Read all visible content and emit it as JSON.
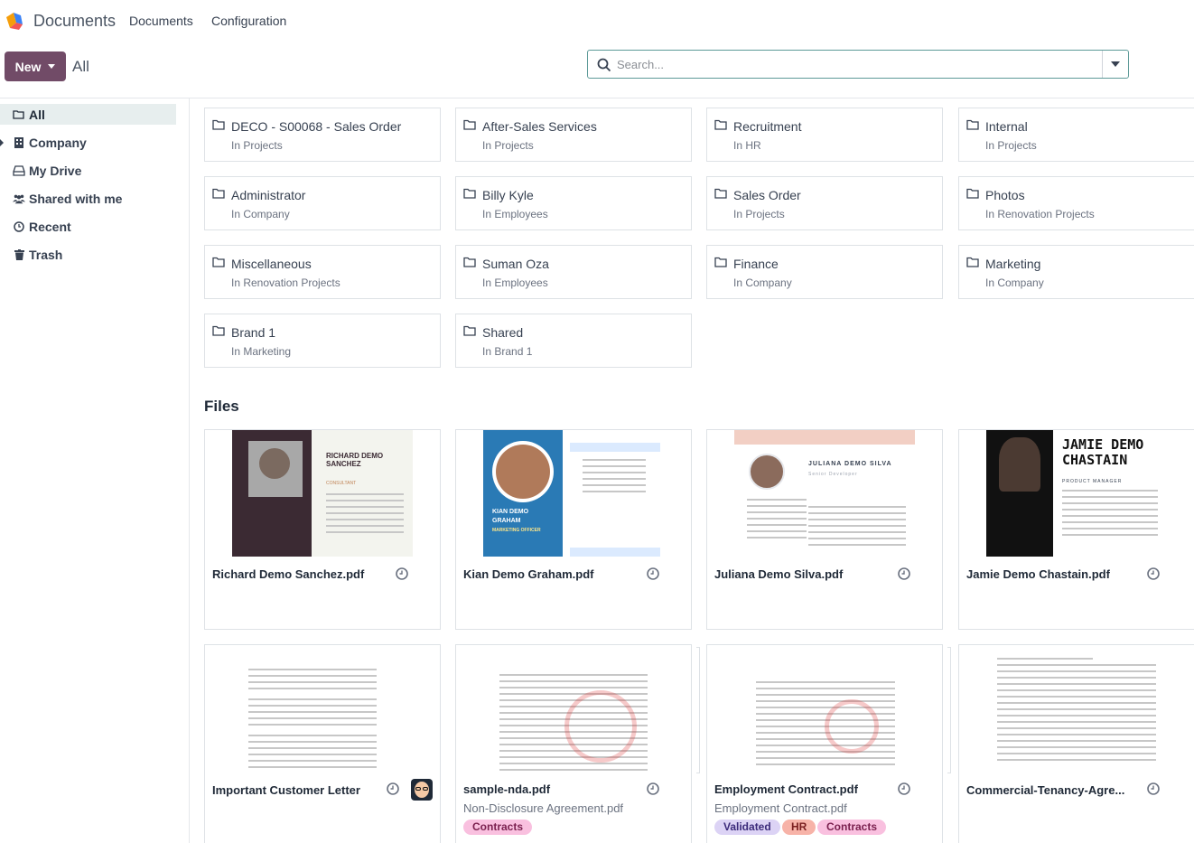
{
  "app": {
    "name": "Documents"
  },
  "nav": {
    "menu": [
      "Documents",
      "Configuration"
    ]
  },
  "control": {
    "new_label": "New",
    "breadcrumb": "All"
  },
  "search": {
    "placeholder": "Search..."
  },
  "sidebar": {
    "items": [
      {
        "label": "All",
        "icon": "folder-open-icon",
        "active": true
      },
      {
        "label": "Company",
        "icon": "building-icon"
      },
      {
        "label": "My Drive",
        "icon": "hdd-icon"
      },
      {
        "label": "Shared with me",
        "icon": "users-icon"
      },
      {
        "label": "Recent",
        "icon": "clock-icon"
      },
      {
        "label": "Trash",
        "icon": "trash-icon"
      }
    ]
  },
  "folders": [
    {
      "name": "DECO - S00068 - Sales Order",
      "location": "In Projects"
    },
    {
      "name": "After-Sales Services",
      "location": "In Projects"
    },
    {
      "name": "Recruitment",
      "location": "In HR"
    },
    {
      "name": "Internal",
      "location": "In Projects"
    },
    {
      "name": "Administrator",
      "location": "In Company"
    },
    {
      "name": "Billy Kyle",
      "location": "In Employees"
    },
    {
      "name": "Sales Order",
      "location": "In Projects"
    },
    {
      "name": "Photos",
      "location": "In Renovation Projects"
    },
    {
      "name": "Miscellaneous",
      "location": "In Renovation Projects"
    },
    {
      "name": "Suman Oza",
      "location": "In Employees"
    },
    {
      "name": "Finance",
      "location": "In Company"
    },
    {
      "name": "Marketing",
      "location": "In Company"
    },
    {
      "name": "Brand 1",
      "location": "In Marketing"
    },
    {
      "name": "Shared",
      "location": "In Brand 1"
    }
  ],
  "files_title": "Files",
  "files": [
    {
      "name": "Richard Demo Sanchez.pdf",
      "thumb": {
        "heading": "RICHARD DEMO SANCHEZ",
        "sub": "CONSULTANT"
      }
    },
    {
      "name": "Kian Demo Graham.pdf",
      "thumb": {
        "heading": "KIAN DEMO GRAHAM",
        "sub": "MARKETING OFFICER"
      }
    },
    {
      "name": "Juliana Demo Silva.pdf",
      "thumb": {
        "heading": "JULIANA DEMO SILVA",
        "sub": "Senior Developer"
      }
    },
    {
      "name": "Jamie Demo Chastain.pdf",
      "thumb": {
        "heading": "JAMIE DEMO CHASTAIN",
        "sub": "PRODUCT MANAGER"
      }
    },
    {
      "name": "Important Customer Letter"
    },
    {
      "name": "sample-nda.pdf",
      "subtitle": "Non-Disclosure Agreement.pdf",
      "tags": [
        "Contracts"
      ]
    },
    {
      "name": "Employment Contract.pdf",
      "subtitle": "Employment Contract.pdf",
      "tags": [
        "Validated",
        "HR",
        "Contracts"
      ]
    },
    {
      "name": "Commercial-Tenancy-Agre..."
    }
  ],
  "colors": {
    "primary": "#714b67",
    "search_border": "#5d9a98",
    "sidebar_active": "#e7eeee"
  }
}
